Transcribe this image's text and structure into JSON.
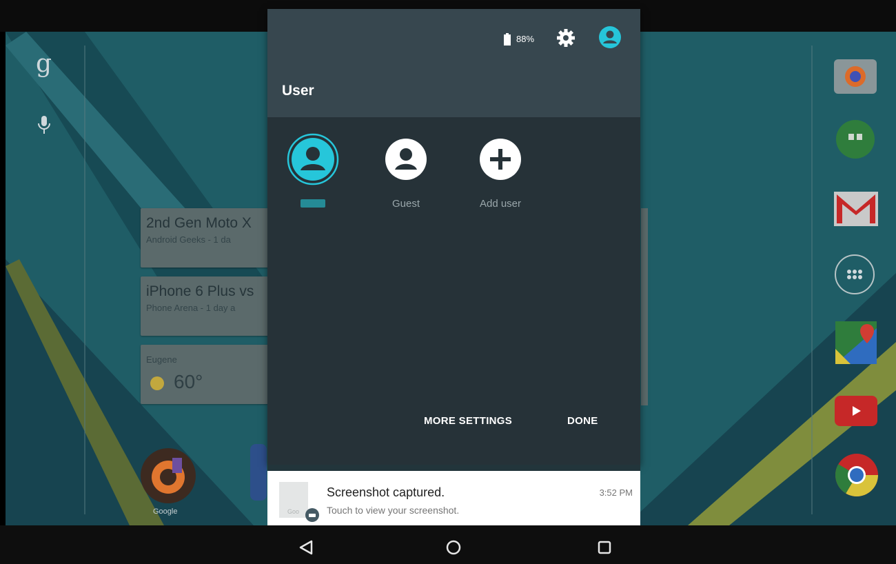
{
  "status": {
    "battery_percent_label": "88%"
  },
  "quick_settings": {
    "title": "User",
    "users": [
      {
        "label": "",
        "selected": true
      },
      {
        "label": "Guest"
      },
      {
        "label": "Add user"
      }
    ],
    "more_settings_label": "MORE SETTINGS",
    "done_label": "DONE"
  },
  "background": {
    "cards": [
      {
        "title": "2nd Gen Moto X",
        "subtitle": "Android Geeks - 1 da"
      },
      {
        "title": "iPhone 6 Plus vs",
        "subtitle": "Phone Arena - 1 day a"
      }
    ],
    "weather": {
      "location": "Eugene",
      "temperature": "60°"
    },
    "dock": {
      "google_label": "Google"
    }
  },
  "notification": {
    "title": "Screenshot captured.",
    "text": "Touch to view your screenshot.",
    "time": "3:52 PM",
    "thumb_label": "Goo"
  },
  "colors": {
    "accent": "#26c6da",
    "panel_bg": "#263238",
    "header_bg": "#37474f"
  }
}
